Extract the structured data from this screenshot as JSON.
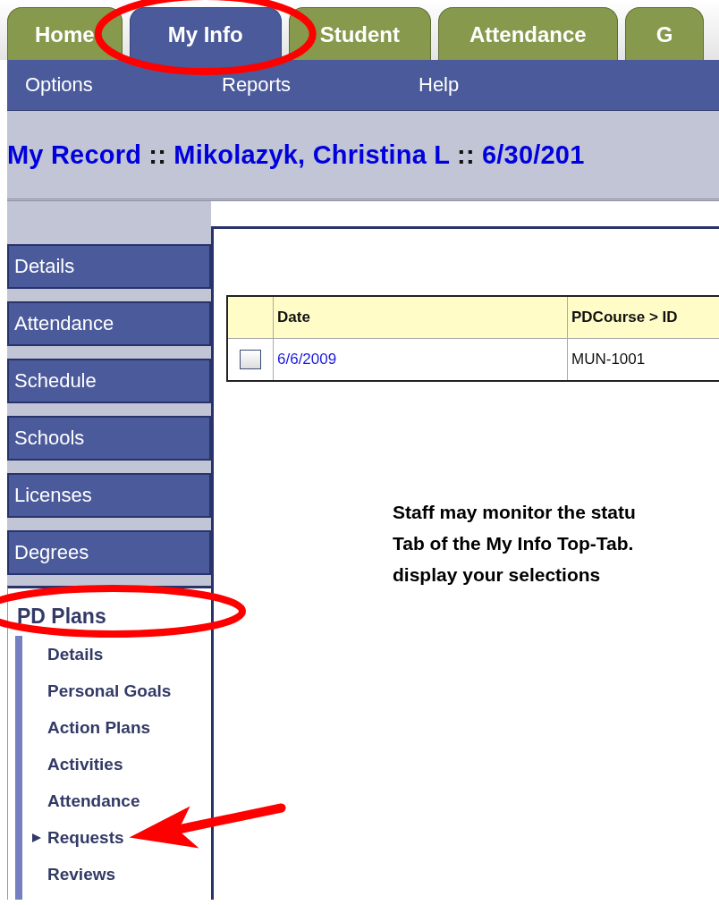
{
  "top_tabs": [
    {
      "label": "Home",
      "selected": false,
      "circled": false
    },
    {
      "label": "My Info",
      "selected": true,
      "circled": true
    },
    {
      "label": "Student",
      "selected": false,
      "circled": false
    },
    {
      "label": "Attendance",
      "selected": false,
      "circled": false
    },
    {
      "label": "G",
      "selected": false,
      "circled": false
    }
  ],
  "sub_menu": [
    "Options",
    "Reports",
    "Help"
  ],
  "page_title": [
    {
      "text": "My Record",
      "kind": "part"
    },
    {
      "text": "::",
      "kind": "separator"
    },
    {
      "text": "Mikolazyk, Christina L",
      "kind": "part"
    },
    {
      "text": "::",
      "kind": "separator"
    },
    {
      "text": "6/30/201",
      "kind": "part"
    }
  ],
  "side_nav": [
    "Details",
    "Attendance",
    "Schedule",
    "Schools",
    "Licenses",
    "Degrees"
  ],
  "pd_plans": {
    "heading": "PD Plans",
    "heading_circled": true,
    "items": [
      {
        "label": "Details",
        "selected": false,
        "pointed_at": false
      },
      {
        "label": "Personal Goals",
        "selected": false,
        "pointed_at": false
      },
      {
        "label": "Action Plans",
        "selected": false,
        "pointed_at": false
      },
      {
        "label": "Activities",
        "selected": false,
        "pointed_at": false
      },
      {
        "label": "Attendance",
        "selected": false,
        "pointed_at": false
      },
      {
        "label": "Requests",
        "selected": true,
        "pointed_at": true
      },
      {
        "label": "Reviews",
        "selected": false,
        "pointed_at": false
      }
    ]
  },
  "table": {
    "columns": [
      "Date",
      "PDCourse > ID"
    ],
    "rows": [
      {
        "checked": false,
        "date": "6/6/2009",
        "pdcourse_id": "MUN-1001"
      }
    ]
  },
  "note": [
    "Staff may monitor the statu",
    "Tab of the My Info Top-Tab.",
    "display your selections"
  ]
}
